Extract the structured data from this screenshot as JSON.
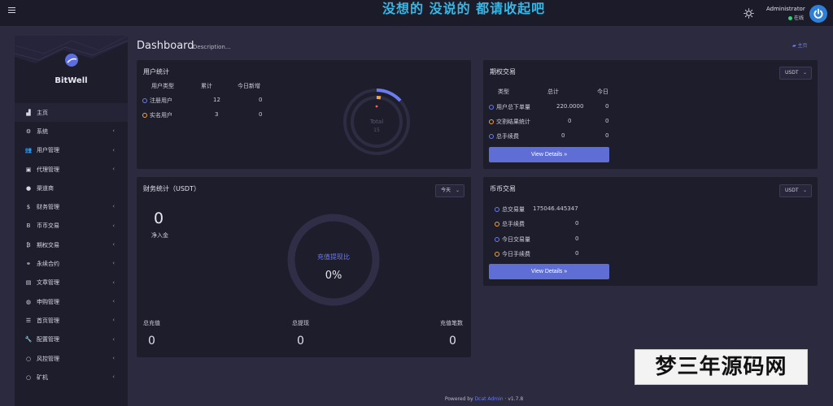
{
  "header": {
    "slogan": "没想的 没说的 都请收起吧",
    "admin_name": "Administrator",
    "admin_status": "在线",
    "icons": {
      "menu": "menu-icon",
      "theme": "sun-icon",
      "avatar": "power-icon"
    }
  },
  "brand": {
    "name": "BitWell",
    "logo_icon": "bitwell-logo-icon"
  },
  "sidebar": {
    "items": [
      {
        "label": "主页",
        "icon": "bar-chart-icon",
        "glyph": "▟",
        "has_children": false,
        "active": true
      },
      {
        "label": "系统",
        "icon": "gear-icon",
        "glyph": "⚙",
        "has_children": true
      },
      {
        "label": "用户管理",
        "icon": "users-icon",
        "glyph": "👥",
        "has_children": true
      },
      {
        "label": "代理管理",
        "icon": "id-card-icon",
        "glyph": "▣",
        "has_children": true
      },
      {
        "label": "渠道商",
        "icon": "user-circle-icon",
        "glyph": "●",
        "has_children": false
      },
      {
        "label": "财务管理",
        "icon": "dollar-icon",
        "glyph": "$",
        "has_children": true
      },
      {
        "label": "币币交易",
        "icon": "bitcoin-icon",
        "glyph": "B",
        "has_children": true
      },
      {
        "label": "期权交易",
        "icon": "bitcoin-small-icon",
        "glyph": "₿",
        "has_children": true
      },
      {
        "label": "永续合约",
        "icon": "link-icon",
        "glyph": "⚭",
        "has_children": true
      },
      {
        "label": "文章管理",
        "icon": "newspaper-icon",
        "glyph": "▤",
        "has_children": true
      },
      {
        "label": "申购管理",
        "icon": "globe-icon",
        "glyph": "◍",
        "has_children": true
      },
      {
        "label": "首页管理",
        "icon": "list-icon",
        "glyph": "☰",
        "has_children": true
      },
      {
        "label": "配置管理",
        "icon": "wrench-icon",
        "glyph": "🔧",
        "has_children": true
      },
      {
        "label": "风控管理",
        "icon": "circle-icon",
        "glyph": "○",
        "has_children": true
      },
      {
        "label": "矿机",
        "icon": "circle-outline-icon",
        "glyph": "○",
        "has_children": true
      }
    ]
  },
  "page": {
    "title": "Dashboard",
    "description": "Description...",
    "breadcrumb": "主页",
    "breadcrumb_icon": "dashboard-icon"
  },
  "user_stats": {
    "title": "用户统计",
    "columns": [
      "用户类型",
      "累计",
      "今日新增"
    ],
    "rows": [
      {
        "label": "注册用户",
        "total": "12",
        "today": "0",
        "color": "#6b7cf0"
      },
      {
        "label": "实名用户",
        "total": "3",
        "today": "0",
        "color": "#f3a440"
      }
    ],
    "donut": {
      "label": "Total",
      "value": "15"
    }
  },
  "options_trading": {
    "title": "期权交易",
    "currency": "USDT",
    "columns": [
      "类型",
      "总计",
      "今日"
    ],
    "rows": [
      {
        "label": "用户总下单量",
        "total": "220.0000",
        "today": "0",
        "color": "#6b7cf0"
      },
      {
        "label": "交割结果统计",
        "total": "0",
        "today": "0",
        "color": "#f3a440"
      },
      {
        "label": "总手续费",
        "total": "0",
        "today": "0",
        "color": "#6b7cf0"
      }
    ],
    "button": "View Details »"
  },
  "finance": {
    "title": "财务统计（USDT）",
    "period": "今天",
    "net_in_value": "0",
    "net_in_label": "净入金",
    "gauge_label": "充值提现比",
    "gauge_value": "0%",
    "footer": [
      {
        "label": "总充值",
        "value": "0"
      },
      {
        "label": "总提现",
        "value": "0"
      },
      {
        "label": "充值笔数",
        "value": "0"
      }
    ]
  },
  "spot_trading": {
    "title": "币币交易",
    "currency": "USDT",
    "rows": [
      {
        "label": "总交易量",
        "value": "175046.445347",
        "color": "#6b7cf0"
      },
      {
        "label": "总手续费",
        "value": "0",
        "color": "#f3a440"
      },
      {
        "label": "今日交易量",
        "value": "0",
        "color": "#6b7cf0"
      },
      {
        "label": "今日手续费",
        "value": "0",
        "color": "#f3a440"
      }
    ],
    "button": "View Details »"
  },
  "footer": {
    "prefix": "Powered by",
    "link": "Dcat Admin",
    "separator": "·",
    "version": "v1.7.8"
  },
  "watermark": "梦三年源码网",
  "colors": {
    "accent": "#5f6ed4",
    "blue": "#6b7cf0",
    "orange": "#f3a440",
    "slogan": "#35b8e6",
    "online": "#2fd56e"
  }
}
